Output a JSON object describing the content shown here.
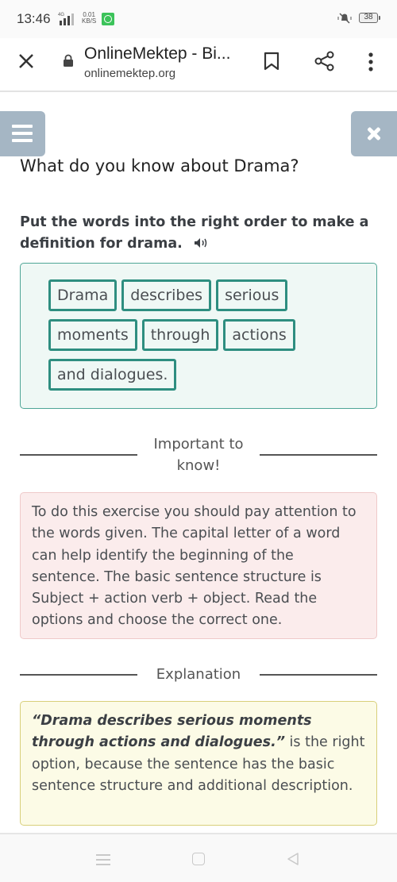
{
  "status_bar": {
    "time": "13:46",
    "network_type": "4G",
    "net_speed_value": "0.01",
    "net_speed_unit": "KB/S",
    "notification_app": "whatsapp-icon",
    "ringer": "muted",
    "battery_level": "38"
  },
  "browser": {
    "page_title": "OnlineMektep - Bi...",
    "url": "onlinemektep.org",
    "icons": [
      "close-icon",
      "lock-icon",
      "bookmark-icon",
      "share-icon",
      "more-vert-icon"
    ]
  },
  "page": {
    "menu_icon": "hamburger-menu-icon",
    "close_icon": "close-icon",
    "title": "What do you know about Drama?",
    "instruction": "Put the words into the right order to make a definition for drama.",
    "audio_icon": "speaker-icon",
    "word_tiles": [
      "Drama",
      "describes",
      "serious",
      "moments",
      "through",
      "actions",
      "and dialogues."
    ],
    "important_label": "Important to know!",
    "hint_text": "To do this exercise you should pay attention to the words given. The capital letter of a word can help identify the beginning of the sentence. The basic sentence structure is Subject + action verb + object. Read the options and choose the correct one.",
    "explanation_label": "Explanation",
    "explanation_quote": "“Drama describes serious moments through actions and dialogues.”",
    "explanation_rest": " is the right option, because the sentence has the basic sentence structure and additional description."
  },
  "nav_bar": {
    "icons": [
      "recent-apps-icon",
      "home-icon",
      "back-icon"
    ]
  },
  "colors": {
    "tile_border": "#2e8e80",
    "word_box_bg": "#eff8f5",
    "hint_bg": "#fbecec",
    "explanation_bg": "#fcfbe6",
    "side_button": "#a5b6c4"
  }
}
